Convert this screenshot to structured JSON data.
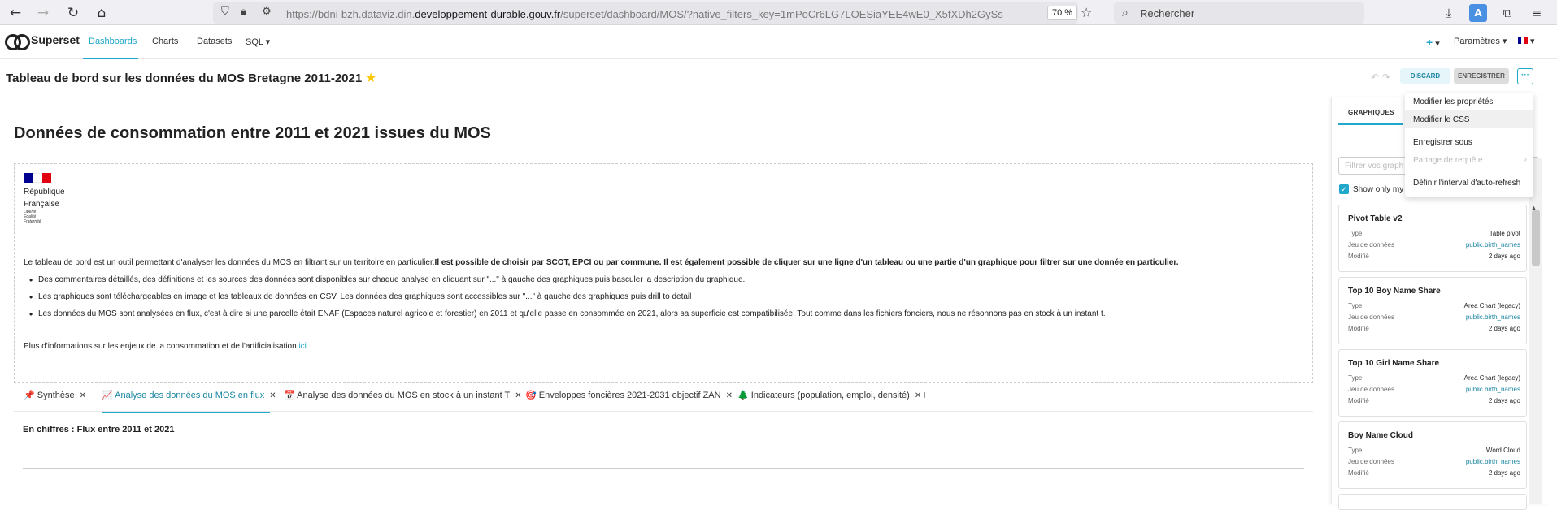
{
  "browser": {
    "url_prefix": "https://bdni-bzh.dataviz.din.",
    "url_domain": "developpement-durable.gouv.fr",
    "url_suffix": "/superset/dashboard/MOS/?native_filters_key=1mPoCr6LG7LOESiaYEE4wE0_X5fXDh2GySs",
    "zoom": "70 %",
    "search_placeholder": "Rechercher"
  },
  "app": {
    "logo": "Superset",
    "nav": [
      "Dashboards",
      "Charts",
      "Datasets",
      "SQL"
    ],
    "plus": "+",
    "settings": "Paramètres"
  },
  "dashboard": {
    "title": "Tableau de bord sur les données du MOS Bretagne 2011-2021",
    "discard": "DISCARD",
    "save": "ENREGISTRER",
    "more": "···"
  },
  "content": {
    "header": "Données de consommation entre 2011 et 2021 issues du MOS",
    "rf_line1": "République",
    "rf_line2": "Française",
    "motto": [
      "Liberté",
      "Égalité",
      "Fraternité"
    ],
    "intro_plain": "Le tableau de bord est un outil permettant d'analyser les données du MOS en filtrant sur un territoire en particulier.",
    "intro_bold": "Il est possible de choisir par SCOT, EPCI ou par commune. Il est également possible de cliquer sur une ligne d'un tableau ou une partie d'un graphique pour filtrer sur une donnée en particulier.",
    "bullets": [
      "Des commentaires détaillés, des définitions et les sources des données sont disponibles sur chaque analyse en cliquant sur \"...\" à gauche des graphiques puis basculer la description du graphique.",
      "Les graphiques sont téléchargeables en image et les tableaux de données en CSV. Les données des graphiques sont accessibles sur \"...\" à gauche des graphiques puis drill to detail",
      "Les données du MOS sont analysées en flux, c'est à dire si une parcelle était ENAF (Espaces naturel agricole et forestier) en 2011 et qu'elle passe en consommée en 2021, alors sa superficie est compatibilisée. Tout comme dans les fichiers fonciers, nous ne résonnons pas en stock à un instant t."
    ],
    "more_info": "Plus d'informations sur les enjeux de la consommation et de l'artificialisation",
    "more_link": "ici",
    "tabs": [
      {
        "icon": "📌",
        "label": "Synthèse"
      },
      {
        "icon": "📈",
        "label": "Analyse des données du MOS en flux"
      },
      {
        "icon": "📅",
        "label": "Analyse des données du MOS en stock à un instant T"
      },
      {
        "icon": "🎯",
        "label": "Enveloppes foncières 2021-2031 objectif ZAN"
      },
      {
        "icon": "🌲",
        "label": "Indicateurs (population, emploi, densité)"
      }
    ],
    "section_heading": "En chiffres : Flux entre 2011 et 2021"
  },
  "panel": {
    "tab_label": "GRAPHIQUES",
    "filter_placeholder": "Filtrer vos graph",
    "checkbox_label": "Show only my c",
    "labels": {
      "type": "Type",
      "dataset": "Jeu de données",
      "modified": "Modifié"
    },
    "cards": [
      {
        "title": "Pivot Table v2",
        "type": "Table pivot",
        "dataset": "public.birth_names",
        "modified": "2 days ago"
      },
      {
        "title": "Top 10 Boy Name Share",
        "type": "Area Chart (legacy)",
        "dataset": "public.birth_names",
        "modified": "2 days ago"
      },
      {
        "title": "Top 10 Girl Name Share",
        "type": "Area Chart (legacy)",
        "dataset": "public.birth_names",
        "modified": "2 days ago"
      },
      {
        "title": "Boy Name Cloud",
        "type": "Word Cloud",
        "dataset": "public.birth_names",
        "modified": "2 days ago"
      }
    ]
  },
  "dropdown": {
    "items": [
      "Modifier les propriétés",
      "Modifier le CSS",
      "Enregistrer sous",
      "Partage de requête",
      "Définir l'interval d'auto-refresh"
    ]
  },
  "colors": {
    "accent": "#20a7c9",
    "star": "#fbc700",
    "flag_blue": "#000091",
    "flag_red": "#e1000f"
  }
}
